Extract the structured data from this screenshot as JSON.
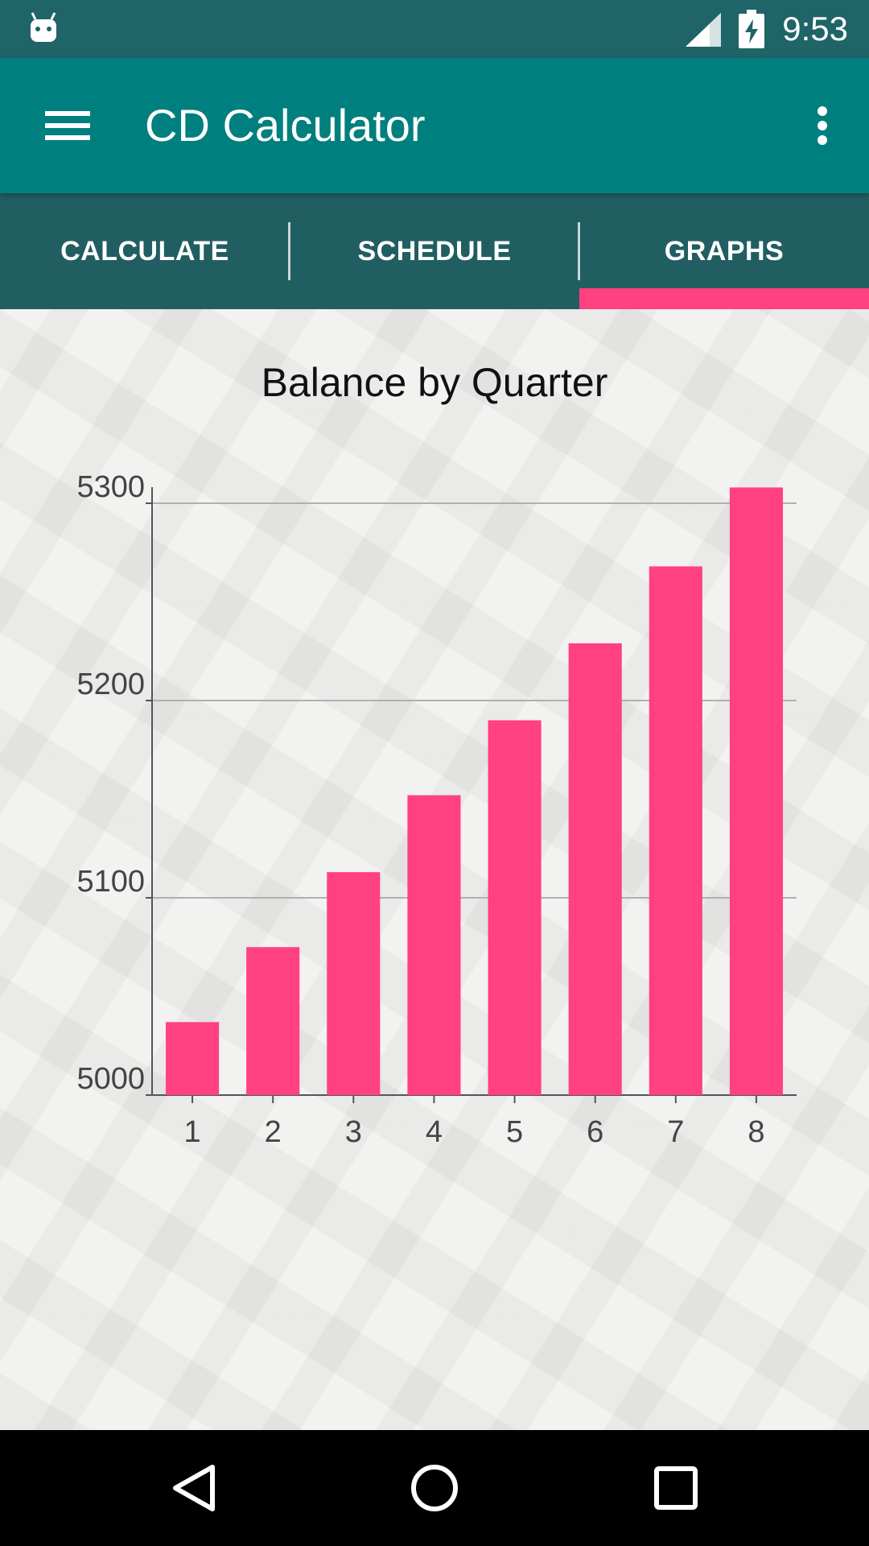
{
  "status_bar": {
    "time": "9:53",
    "icons": [
      "android-debug-icon",
      "cell-signal-icon",
      "battery-charging-icon"
    ]
  },
  "app_bar": {
    "title": "CD Calculator",
    "menu_icon": "hamburger-menu-icon",
    "overflow_icon": "more-vert-icon",
    "color": "#007f7f"
  },
  "tabs": [
    {
      "label": "CALCULATE",
      "selected": false
    },
    {
      "label": "SCHEDULE",
      "selected": false
    },
    {
      "label": "GRAPHS",
      "selected": true
    }
  ],
  "colors": {
    "status_bar": "#1f6467",
    "tab_bar": "#215e61",
    "accent": "#ff4081",
    "bar": "#ff4081"
  },
  "chart_data": {
    "type": "bar",
    "title": "Balance by Quarter",
    "xlabel": "",
    "ylabel": "",
    "categories": [
      "1",
      "2",
      "3",
      "4",
      "5",
      "6",
      "7",
      "8"
    ],
    "values": [
      5037,
      5075,
      5113,
      5152,
      5190,
      5229,
      5268,
      5308
    ],
    "ylim": [
      5000,
      5300
    ],
    "yticks": [
      "5000",
      "5100",
      "5200",
      "5300"
    ],
    "grid": true
  },
  "nav_bar": {
    "icons": [
      "back-icon",
      "home-icon",
      "recents-icon"
    ]
  }
}
